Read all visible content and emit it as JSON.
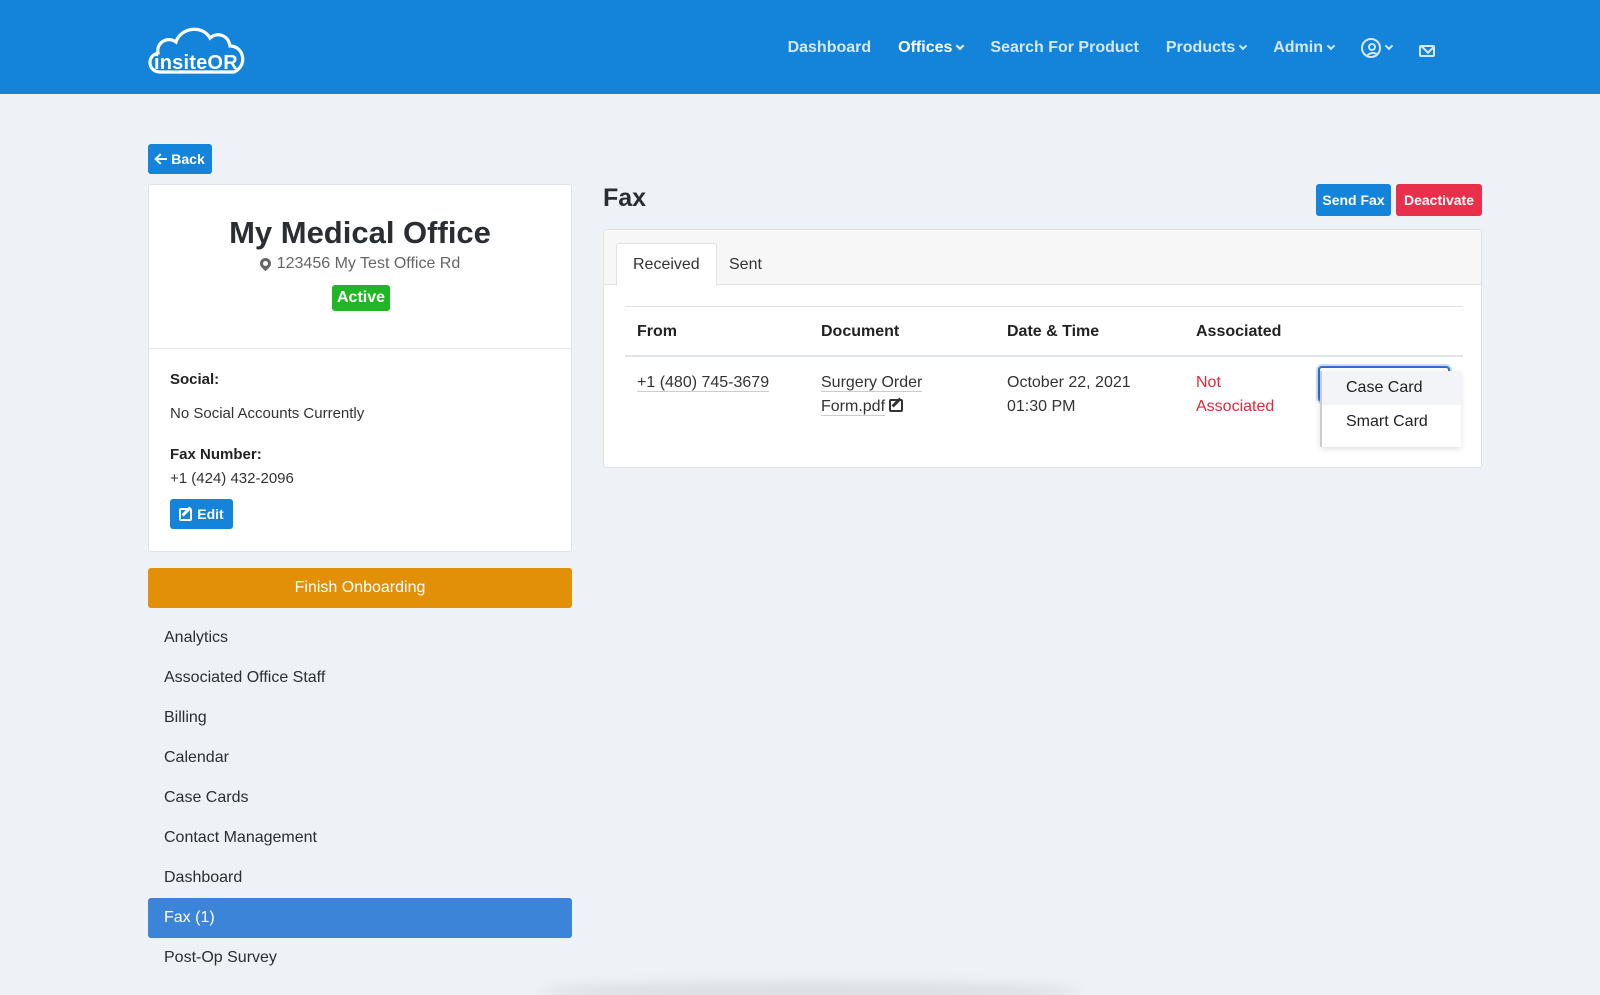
{
  "brand": {
    "logo_text": "insiteOR"
  },
  "nav": {
    "items": [
      {
        "label": "Dashboard",
        "active": false,
        "dropdown": false
      },
      {
        "label": "Offices",
        "active": true,
        "dropdown": true
      },
      {
        "label": "Search For Product",
        "active": false,
        "dropdown": false
      },
      {
        "label": "Products",
        "active": false,
        "dropdown": true
      },
      {
        "label": "Admin",
        "active": false,
        "dropdown": true
      }
    ],
    "user_icon": "user-circle-icon",
    "mail_icon": "envelope-icon"
  },
  "back_label": "Back",
  "office": {
    "name": "My Medical Office",
    "address": "123456 My Test Office Rd",
    "status": "Active",
    "social_label": "Social:",
    "social_value": "No Social Accounts Currently",
    "fax_label": "Fax Number:",
    "fax_value": "+1 (424) 432-2096",
    "edit_label": "Edit"
  },
  "finish_label": "Finish Onboarding",
  "sidebar": {
    "items": [
      {
        "label": "Analytics",
        "active": false
      },
      {
        "label": "Associated Office Staff",
        "active": false
      },
      {
        "label": "Billing",
        "active": false
      },
      {
        "label": "Calendar",
        "active": false
      },
      {
        "label": "Case Cards",
        "active": false
      },
      {
        "label": "Contact Management",
        "active": false
      },
      {
        "label": "Dashboard",
        "active": false
      },
      {
        "label": "Fax (1)",
        "active": true
      },
      {
        "label": "Post-Op Survey",
        "active": false
      }
    ]
  },
  "fax": {
    "title": "Fax",
    "send_label": "Send Fax",
    "deactivate_label": "Deactivate",
    "tabs": [
      {
        "label": "Received",
        "active": true
      },
      {
        "label": "Sent",
        "active": false
      }
    ],
    "columns": [
      "From",
      "Document",
      "Date & Time",
      "Associated"
    ],
    "row": {
      "from": "+1 (480) 745-3679",
      "doc_line1": "Surgery Order",
      "doc_line2": "Form.pdf",
      "date": "October 22, 2021",
      "time": "01:30 PM",
      "assoc_line1": "Not",
      "assoc_line2": "Associated"
    },
    "dropdown_options": [
      "Case Card",
      "Smart Card"
    ]
  },
  "colors": {
    "primary": "#1384d9",
    "success": "#1fb824",
    "warning": "#e19008",
    "danger": "#e8304c",
    "sidebar_active": "#3c84d8"
  }
}
